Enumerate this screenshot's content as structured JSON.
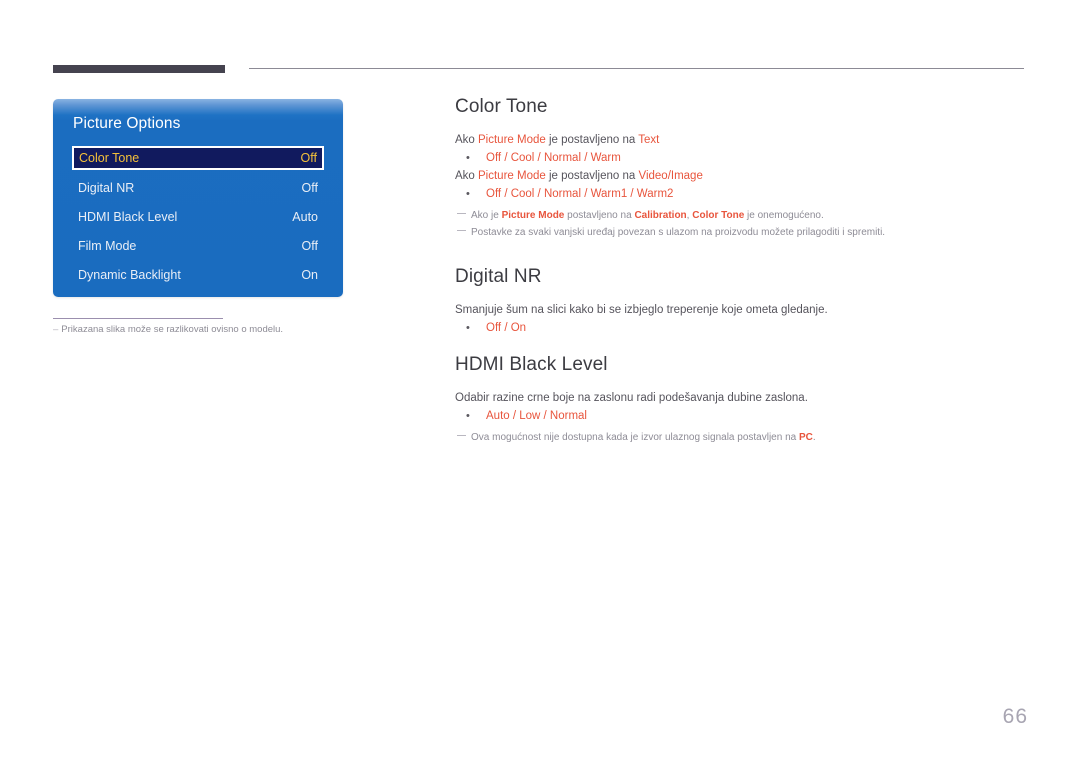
{
  "page": {
    "number": "66"
  },
  "osd": {
    "title": "Picture Options",
    "rows": [
      {
        "label": "Color Tone",
        "value": "Off",
        "selected": true
      },
      {
        "label": "Digital NR",
        "value": "Off",
        "selected": false
      },
      {
        "label": "HDMI Black Level",
        "value": "Auto",
        "selected": false
      },
      {
        "label": "Film Mode",
        "value": "Off",
        "selected": false
      },
      {
        "label": "Dynamic Backlight",
        "value": "On",
        "selected": false
      }
    ],
    "note_dash": "–",
    "note": "Prikazana slika može se razlikovati ovisno o modelu."
  },
  "sections": {
    "color_tone": {
      "title": "Color Tone",
      "line1_a": "Ako ",
      "line1_b": "Picture Mode",
      "line1_c": " je postavljeno na ",
      "line1_d": "Text",
      "options1": "Off / Cool / Normal / Warm",
      "line2_a": "Ako ",
      "line2_b": "Picture Mode",
      "line2_c": " je postavljeno na ",
      "line2_d": "Video/Image",
      "options2": "Off / Cool / Normal / Warm1 / Warm2",
      "note1_a": "Ako je ",
      "note1_b": "Picture Mode",
      "note1_c": " postavljeno na ",
      "note1_d": "Calibration",
      "note1_e": ", ",
      "note1_f": "Color Tone",
      "note1_g": " je onemogućeno.",
      "note2": "Postavke za svaki vanjski uređaj povezan s ulazom na proizvodu možete prilagoditi i spremiti."
    },
    "digital_nr": {
      "title": "Digital NR",
      "desc": "Smanjuje šum na slici kako bi se izbjeglo treperenje koje ometa gledanje.",
      "options": "Off / On"
    },
    "hdmi_black_level": {
      "title": "HDMI Black Level",
      "desc": "Odabir razine crne boje na zaslonu radi podešavanja dubine zaslona.",
      "options": "Auto / Low / Normal",
      "note_a": "Ova mogućnost nije dostupna kada je izvor ulaznog signala postavljen na ",
      "note_b": "PC",
      "note_c": "."
    }
  },
  "colors": {
    "accent": "#e8553d",
    "osd_blue": "#1a6cbf",
    "osd_selected_bg": "#111a5e",
    "osd_selected_text": "#f5c13a",
    "header_bar": "#45434f",
    "body_text": "#56545c",
    "note_text": "#8e8c96"
  }
}
